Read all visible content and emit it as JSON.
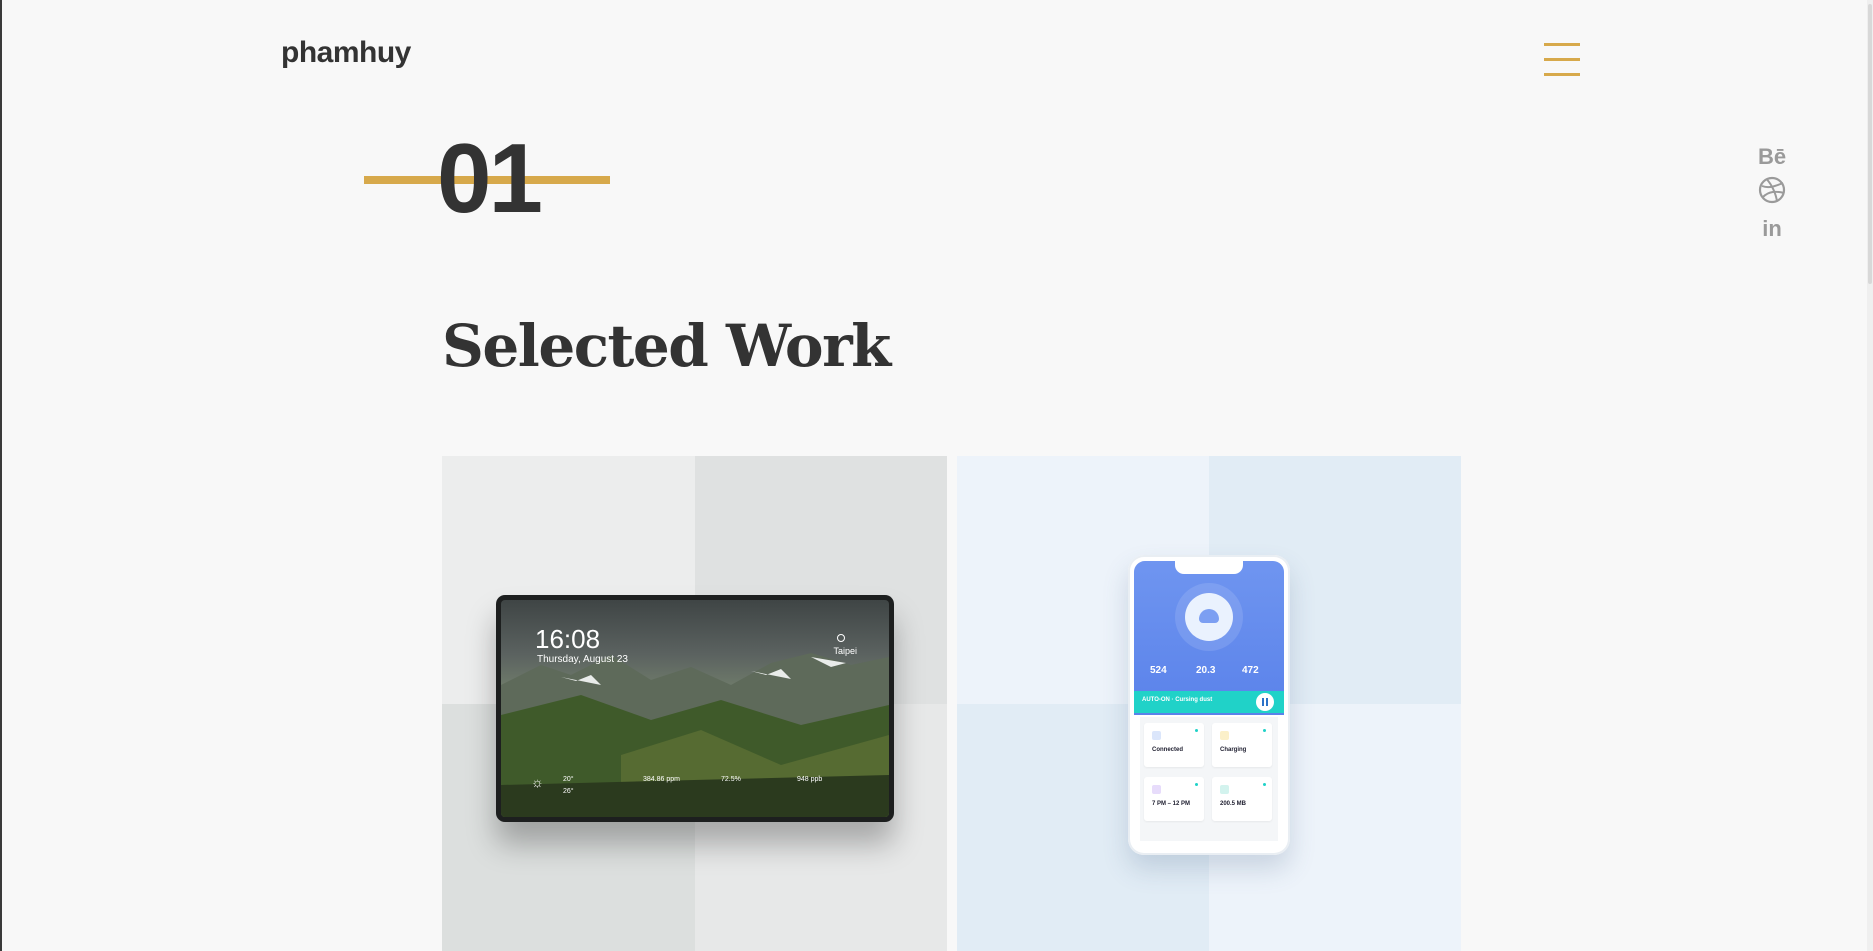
{
  "header": {
    "logo": "phamhuy"
  },
  "section": {
    "number": "01",
    "title": "Selected Work"
  },
  "social": {
    "behance": "Bē",
    "linkedin": "in"
  },
  "colors": {
    "accent": "#d7a94b",
    "text": "#333333",
    "background": "#f8f8f8",
    "social_icon": "#9a9a9a"
  },
  "icons": [
    "menu-icon",
    "behance-icon",
    "dribbble-icon",
    "linkedin-icon"
  ],
  "projects": [
    {
      "device": "tablet",
      "screen": {
        "time": "16:08",
        "date": "Thursday, August 23",
        "location": "Taipei",
        "weather": [
          "20°",
          "26°"
        ],
        "readings": [
          "384.86 ppm",
          "72.5%",
          "948 ppb"
        ]
      }
    },
    {
      "device": "phone",
      "screen": {
        "stats": [
          "524",
          "20.3",
          "472"
        ],
        "banner": "AUTO-ON · Cursing dust",
        "tiles": [
          "Connected",
          "Charging",
          "7 PM – 12 PM",
          "200.5 MB"
        ]
      }
    }
  ]
}
